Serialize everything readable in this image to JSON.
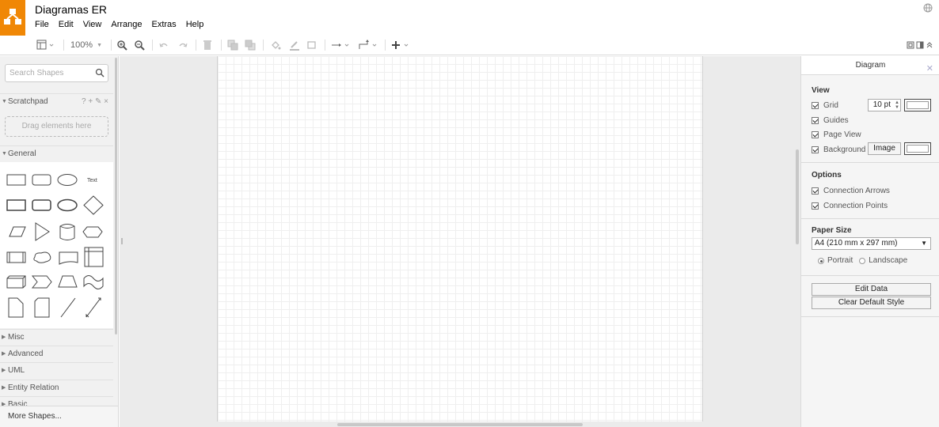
{
  "header": {
    "title": "Diagramas ER",
    "menu": [
      "File",
      "Edit",
      "View",
      "Arrange",
      "Extras",
      "Help"
    ]
  },
  "toolbar": {
    "zoom": "100%",
    "icons": [
      "page-view-icon",
      "zoom-in-icon",
      "zoom-out-icon",
      "undo-icon",
      "redo-icon",
      "delete-icon",
      "to-front-icon",
      "to-back-icon",
      "fill-color-icon",
      "line-color-icon",
      "shadow-icon",
      "connection-icon",
      "waypoints-icon",
      "insert-icon",
      "fullscreen-icon",
      "format-panel-icon",
      "collapse-icon"
    ]
  },
  "sidebar": {
    "search_placeholder": "Search Shapes",
    "scratchpad_label": "Scratchpad",
    "scratchpad_tools": "? + ✎ ×",
    "drop_label": "Drag elements here",
    "general_label": "General",
    "text_shape_label": "Text",
    "sections": [
      "Misc",
      "Advanced",
      "UML",
      "Entity Relation",
      "Basic"
    ],
    "more_shapes": "More Shapes..."
  },
  "panel": {
    "tab": "Diagram",
    "view_title": "View",
    "grid_label": "Grid",
    "grid_size": "10 pt",
    "guides_label": "Guides",
    "page_view_label": "Page View",
    "background_label": "Background",
    "image_button": "Image",
    "options_title": "Options",
    "connection_arrows": "Connection Arrows",
    "connection_points": "Connection Points",
    "paper_size_title": "Paper Size",
    "paper_size_value": "A4 (210 mm x 297 mm)",
    "portrait": "Portrait",
    "landscape": "Landscape",
    "orientation": "Portrait",
    "edit_data": "Edit Data",
    "clear_default_style": "Clear Default Style"
  },
  "colors": {
    "logo": "#f08705",
    "accent": "#4285f4"
  }
}
